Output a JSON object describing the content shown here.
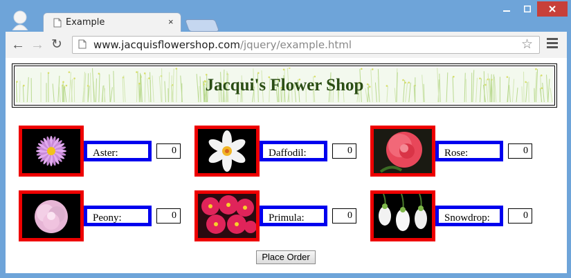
{
  "browser": {
    "tab_title": "Example",
    "tab_close": "×",
    "url_host": "www.jacquisflowershop.com",
    "url_path": "/jquery/example.html"
  },
  "page": {
    "title": "Jacqui's Flower Shop",
    "order_button": "Place Order",
    "flowers": [
      {
        "label": "Aster:",
        "qty": "0"
      },
      {
        "label": "Daffodil:",
        "qty": "0"
      },
      {
        "label": "Rose:",
        "qty": "0"
      },
      {
        "label": "Peony:",
        "qty": "0"
      },
      {
        "label": "Primula:",
        "qty": "0"
      },
      {
        "label": "Snowdrop:",
        "qty": "0"
      }
    ]
  },
  "colors": {
    "thumb_border": "#ee0000",
    "label_border": "#0000ee",
    "title": "#2a4d14"
  }
}
